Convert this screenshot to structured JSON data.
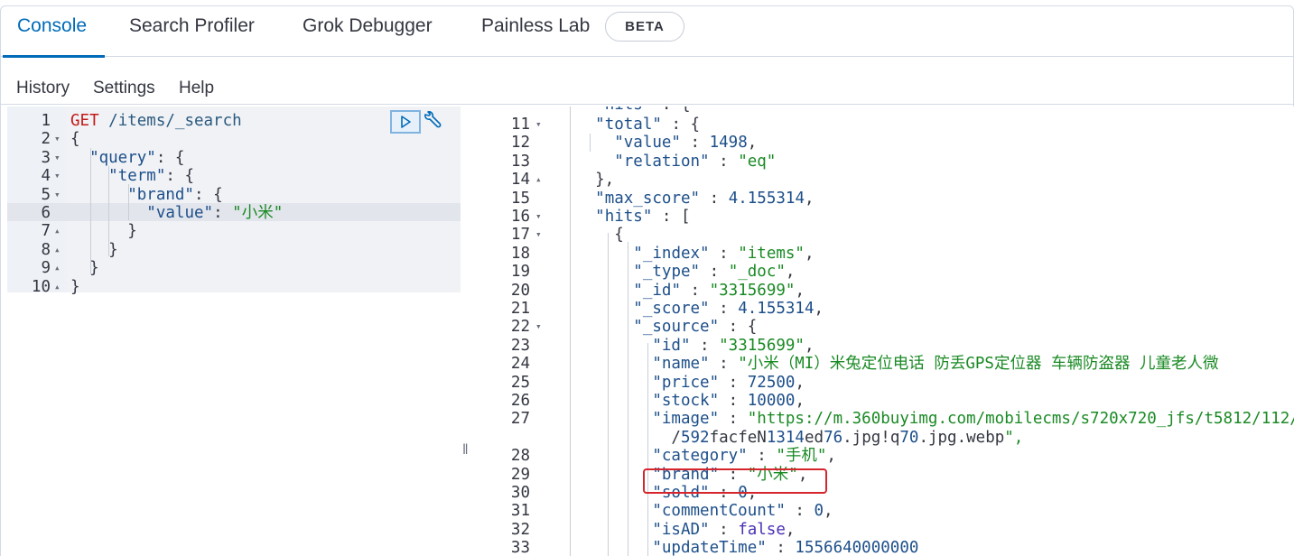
{
  "tabs": {
    "console": "Console",
    "search_profiler": "Search Profiler",
    "grok_debugger": "Grok Debugger",
    "painless_lab": "Painless Lab",
    "beta_badge": "BETA"
  },
  "toolbar": {
    "history": "History",
    "settings": "Settings",
    "help": "Help"
  },
  "request": [
    {
      "n": "1",
      "fold": "",
      "code": "GET /items/_search"
    },
    {
      "n": "2",
      "fold": "▾",
      "code": "{"
    },
    {
      "n": "3",
      "fold": "▾",
      "code": "  \"query\": {"
    },
    {
      "n": "4",
      "fold": "▾",
      "code": "    \"term\": {"
    },
    {
      "n": "5",
      "fold": "▾",
      "code": "      \"brand\": {"
    },
    {
      "n": "6",
      "fold": "",
      "code": "        \"value\": \"小米\""
    },
    {
      "n": "7",
      "fold": "▴",
      "code": "      }"
    },
    {
      "n": "8",
      "fold": "▴",
      "code": "    }"
    },
    {
      "n": "9",
      "fold": "▴",
      "code": "  }"
    },
    {
      "n": "10",
      "fold": "▴",
      "code": "}"
    }
  ],
  "response": [
    {
      "n": "11",
      "fold": "▾",
      "code": "    \"total\" : {"
    },
    {
      "n": "12",
      "fold": "",
      "code": "      \"value\" : 1498,"
    },
    {
      "n": "13",
      "fold": "",
      "code": "      \"relation\" : \"eq\""
    },
    {
      "n": "14",
      "fold": "▴",
      "code": "    },"
    },
    {
      "n": "15",
      "fold": "",
      "code": "    \"max_score\" : 4.155314,"
    },
    {
      "n": "16",
      "fold": "▾",
      "code": "    \"hits\" : ["
    },
    {
      "n": "17",
      "fold": "▾",
      "code": "      {"
    },
    {
      "n": "18",
      "fold": "",
      "code": "        \"_index\" : \"items\","
    },
    {
      "n": "19",
      "fold": "",
      "code": "        \"_type\" : \"_doc\","
    },
    {
      "n": "20",
      "fold": "",
      "code": "        \"_id\" : \"3315699\","
    },
    {
      "n": "21",
      "fold": "",
      "code": "        \"_score\" : 4.155314,"
    },
    {
      "n": "22",
      "fold": "▾",
      "code": "        \"_source\" : {"
    },
    {
      "n": "23",
      "fold": "",
      "code": "          \"id\" : \"3315699\","
    },
    {
      "n": "24",
      "fold": "",
      "code": "          \"name\" : \"小米（MI）米兔定位电话 防丢GPS定位器 车辆防盗器 儿童老人微"
    },
    {
      "n": "25",
      "fold": "",
      "code": "          \"price\" : 72500,"
    },
    {
      "n": "26",
      "fold": "",
      "code": "          \"stock\" : 10000,"
    },
    {
      "n": "27",
      "fold": "",
      "code": "          \"image\" : \"https://m.360buyimg.com/mobilecms/s720x720_jfs/t5812/112/"
    },
    {
      "n": "",
      "fold": "",
      "code": "            /592facfeN1314ed76.jpg!q70.jpg.webp\","
    },
    {
      "n": "28",
      "fold": "",
      "code": "          \"category\" : \"手机\","
    },
    {
      "n": "29",
      "fold": "",
      "code": "          \"brand\" : \"小米\","
    },
    {
      "n": "30",
      "fold": "",
      "code": "          \"sold\" : 0,"
    },
    {
      "n": "31",
      "fold": "",
      "code": "          \"commentCount\" : 0,"
    },
    {
      "n": "32",
      "fold": "",
      "code": "          \"isAD\" : false,"
    },
    {
      "n": "33",
      "fold": "",
      "code": "          \"updateTime\" : 1556640000000"
    }
  ],
  "partial_top_line": "    \"hits\" : {",
  "icons": {
    "run": "play-icon",
    "wrench": "wrench-icon",
    "splitter": "resize-handle"
  },
  "colors": {
    "accent": "#006bb8",
    "highlight": "#d6262d"
  }
}
